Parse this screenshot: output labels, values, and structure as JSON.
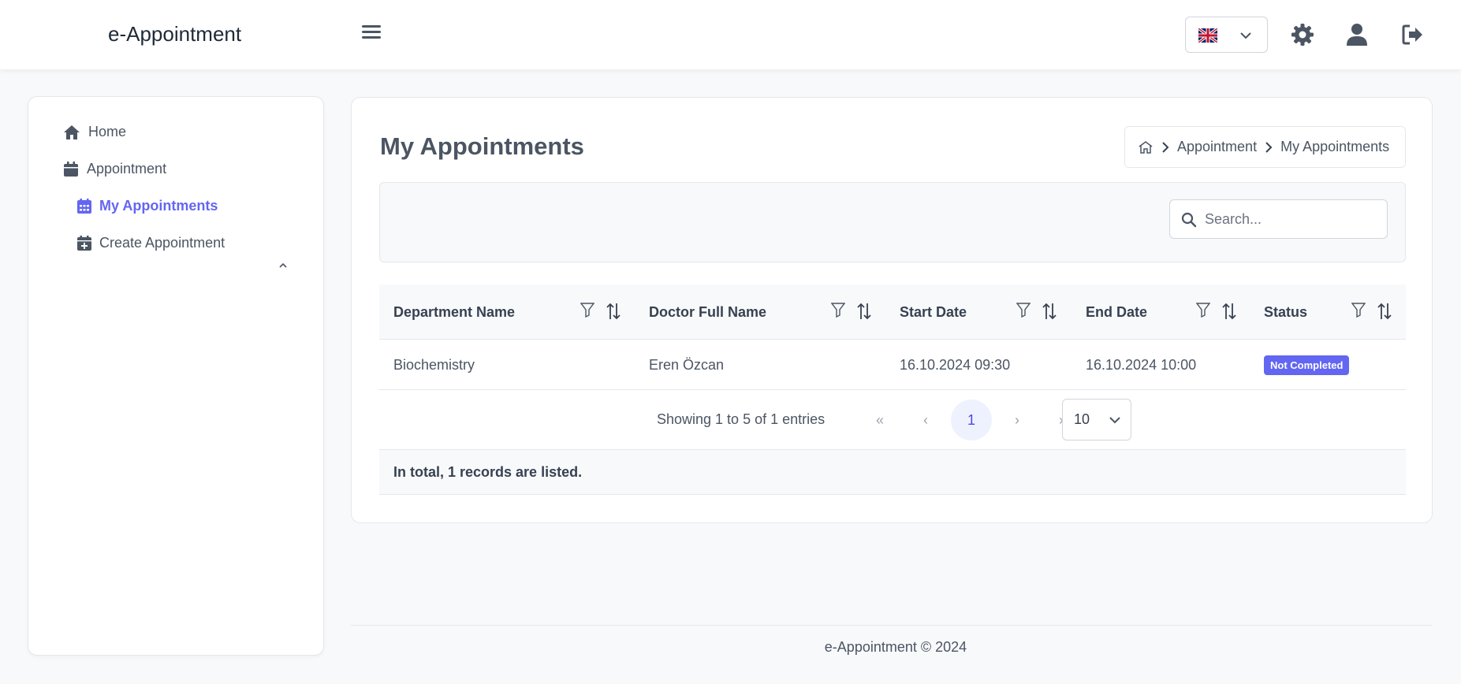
{
  "header": {
    "app_title": "e-Appointment",
    "language_flag": "uk-flag-icon",
    "icons": [
      "menu-icon",
      "gear-icon",
      "user-icon",
      "logout-icon"
    ]
  },
  "sidebar": {
    "items": [
      {
        "label": "Home",
        "icon": "home-icon"
      },
      {
        "label": "Appointment",
        "icon": "calendar-icon",
        "expanded": true
      },
      {
        "label": "My Appointments",
        "icon": "calendar-days-icon",
        "active": true
      },
      {
        "label": "Create Appointment",
        "icon": "calendar-plus-icon"
      }
    ]
  },
  "page": {
    "title": "My Appointments",
    "breadcrumb": [
      "Appointment",
      "My Appointments"
    ]
  },
  "search": {
    "placeholder": "Search...",
    "value": ""
  },
  "table": {
    "columns": [
      "Department Name",
      "Doctor Full Name",
      "Start Date",
      "End Date",
      "Status"
    ],
    "rows": [
      {
        "department": "Biochemistry",
        "doctor": "Eren Özcan",
        "start": "16.10.2024 09:30",
        "end": "16.10.2024 10:00",
        "status": "Not Completed"
      }
    ],
    "footer": "In total, 1 records are listed."
  },
  "pagination": {
    "info": "Showing 1 to 5 of 1 entries",
    "first": "«",
    "prev": "‹",
    "current": "1",
    "next": "›",
    "last": "»",
    "rows_per_page": "10"
  },
  "footer": {
    "text": "e-Appointment © 2024"
  },
  "colors": {
    "accent": "#6366f1",
    "text": "#4b5563",
    "background": "#f8f9fb"
  }
}
